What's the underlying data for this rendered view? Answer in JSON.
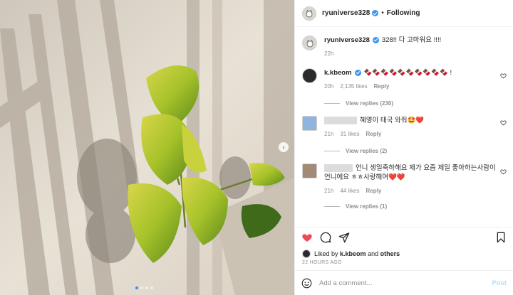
{
  "post": {
    "username": "ryuniverse328",
    "follow_label": "Following",
    "caption_user": "ryuniverse328",
    "caption_text": "328!! 다 고마워요 !!!!",
    "caption_time": "22h"
  },
  "comments": [
    {
      "user": "k.kbeom",
      "text": "🍫🍫🍫🍫🍫🍫🍫🍫🍫🍫 !",
      "time": "20h",
      "likes": "2,135 likes",
      "reply": "Reply",
      "view_replies": "View replies (230)"
    },
    {
      "user": "",
      "text": "혜영이 태국 와줘🤩❤️",
      "time": "21h",
      "likes": "31 likes",
      "reply": "Reply",
      "view_replies": "View replies (2)"
    },
    {
      "user": "",
      "text": "언니 생일축하해요 제가 요즘 제일 좋아하는사람이 언니에요 ㅎㅎ사랑해여❤️❤️",
      "time": "21h",
      "likes": "44 likes",
      "reply": "Reply",
      "view_replies": "View replies (1)"
    }
  ],
  "likes": {
    "prefix": "Liked by",
    "user": "k.kbeom",
    "and": "and",
    "others": "others"
  },
  "timestamp": "22 HOURS AGO",
  "add_comment": {
    "placeholder": "Add a comment...",
    "post_label": "Post"
  },
  "colors": {
    "verified": "#3897f0",
    "liked_heart": "#ed4956",
    "post_button": "#b2dffc"
  }
}
